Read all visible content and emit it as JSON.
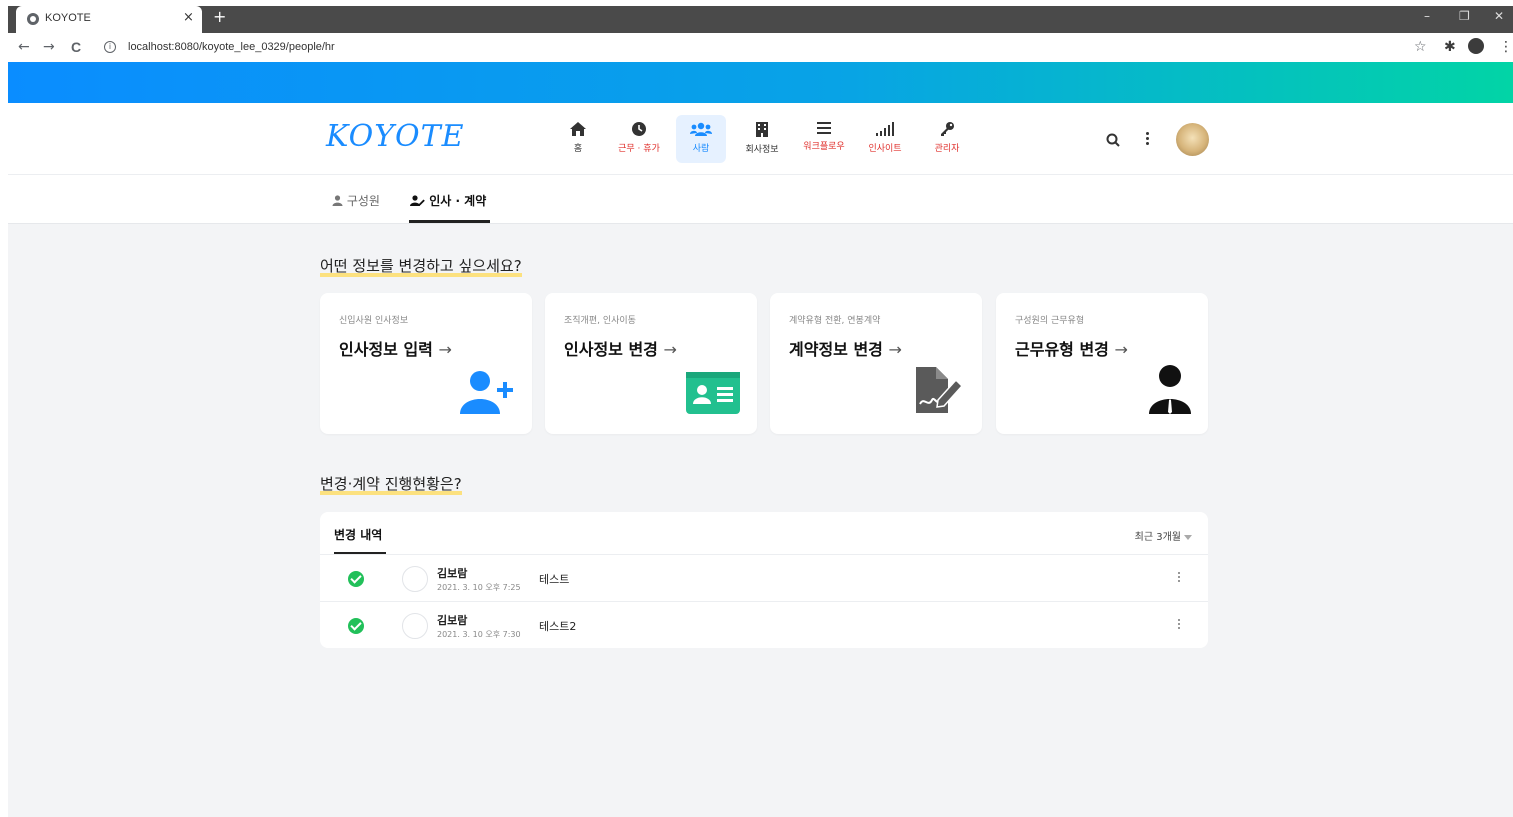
{
  "browser": {
    "tab_title": "KOYOTE",
    "tab_close": "×",
    "new_tab": "+",
    "url": "localhost:8080/koyote_lee_0329/people/hr",
    "win_minimize": "–",
    "win_restore": "❐",
    "win_close": "✕",
    "back": "←",
    "forward": "→",
    "reload": "C",
    "info": "i",
    "star": "☆",
    "extensions": "✱",
    "menu": "⋮"
  },
  "header": {
    "logo": "KOYOTE",
    "nav": [
      {
        "label": "홈",
        "icon": "home-icon",
        "color": "dark"
      },
      {
        "label": "근무 · 휴가",
        "icon": "clock-icon",
        "color": "red"
      },
      {
        "label": "사람",
        "icon": "people-icon",
        "color": "blue",
        "active": true
      },
      {
        "label": "회사정보",
        "icon": "building-icon",
        "color": "dark"
      },
      {
        "label": "워크플로우",
        "icon": "list-icon",
        "color": "red"
      },
      {
        "label": "인사이트",
        "icon": "signal-icon",
        "color": "red"
      },
      {
        "label": "관리자",
        "icon": "key-icon",
        "color": "red"
      }
    ]
  },
  "subtabs": {
    "members": "구성원",
    "hr_contract": "인사 · 계약"
  },
  "section1": {
    "title": "어떤 정보를 변경하고 싶으세요?",
    "cards": [
      {
        "sub": "신입사원 인사정보",
        "title": "인사정보 입력",
        "icon": "add-user-icon",
        "color": "#1a8cff"
      },
      {
        "sub": "조직개편, 인사이동",
        "title": "인사정보 변경",
        "icon": "id-card-icon",
        "color": "#22c08f"
      },
      {
        "sub": "계약유형 전환, 연봉계약",
        "title": "계약정보 변경",
        "icon": "contract-sign-icon",
        "color": "#555555"
      },
      {
        "sub": "구성원의 근무유형",
        "title": "근무유형 변경",
        "icon": "suit-person-icon",
        "color": "#111111"
      }
    ],
    "arrow": "→"
  },
  "section2": {
    "title": "변경·계약 진행현황은?",
    "panel_tab": "변경 내역",
    "filter": "최근 3개월",
    "rows": [
      {
        "name": "김보람",
        "date": "2021. 3. 10 오후 7:25",
        "title": "테스트"
      },
      {
        "name": "김보람",
        "date": "2021. 3. 10 오후 7:30",
        "title": "테스트2"
      }
    ]
  }
}
